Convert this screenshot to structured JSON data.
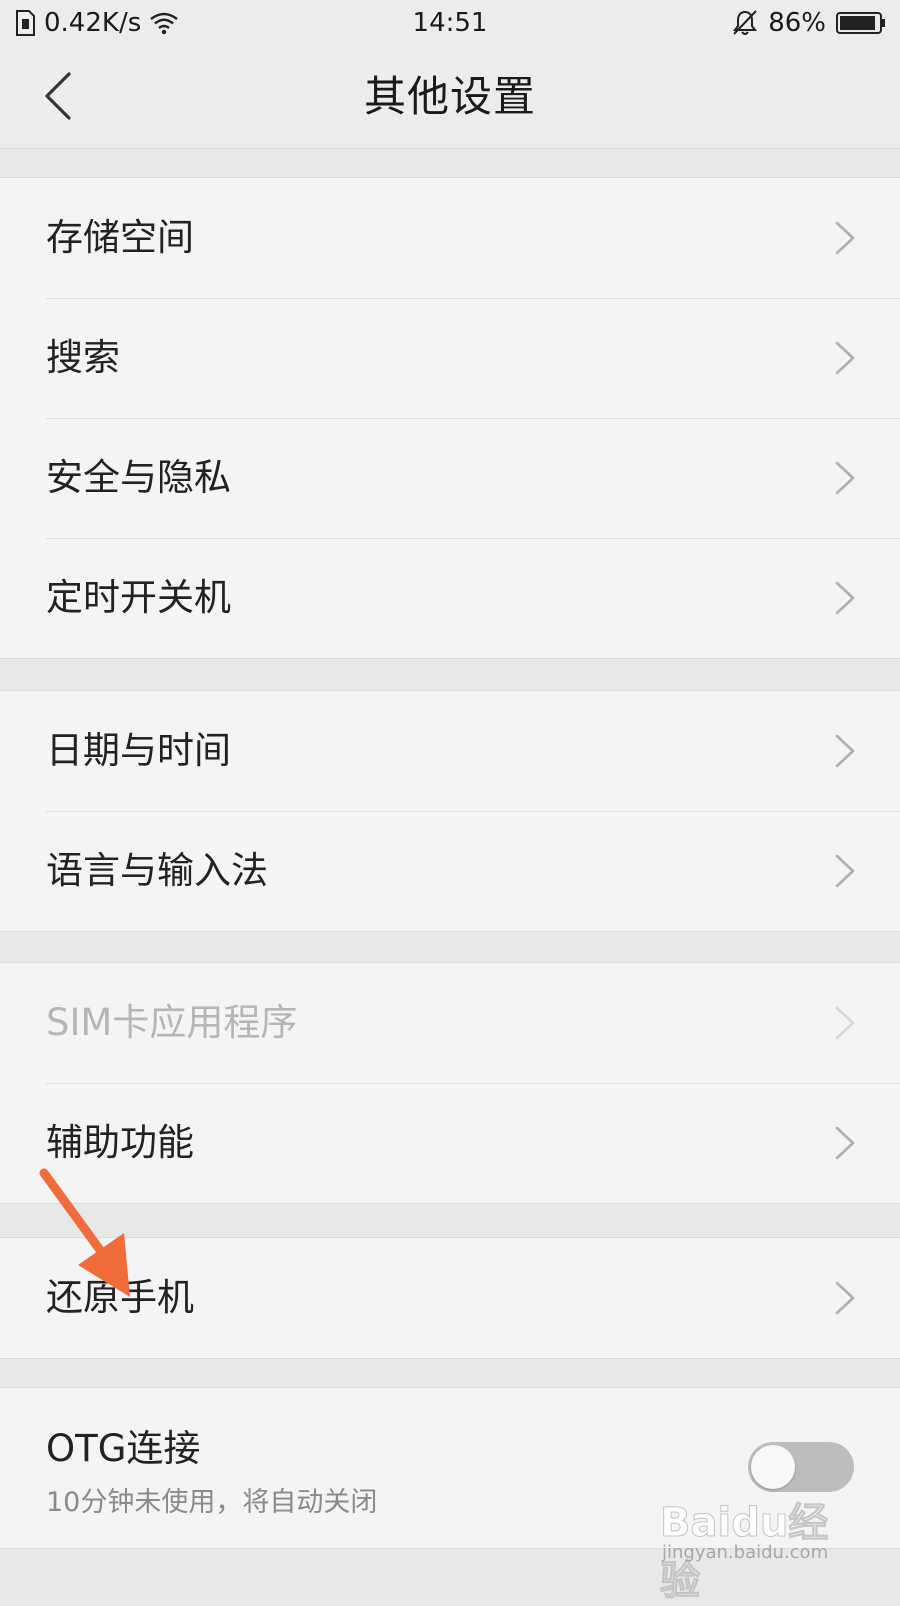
{
  "status_bar": {
    "net_speed": "0.42K/s",
    "time": "14:51",
    "battery": "86%",
    "icons": [
      "sim-icon",
      "wifi-icon",
      "bell-off-icon",
      "battery-icon"
    ]
  },
  "header": {
    "title": "其他设置",
    "back_icon": "chevron-left-icon"
  },
  "groups": [
    {
      "items": [
        {
          "label": "存储空间"
        },
        {
          "label": "搜索"
        },
        {
          "label": "安全与隐私"
        },
        {
          "label": "定时开关机"
        }
      ]
    },
    {
      "items": [
        {
          "label": "日期与时间"
        },
        {
          "label": "语言与输入法"
        }
      ]
    },
    {
      "items": [
        {
          "label": "SIM卡应用程序",
          "disabled": true
        },
        {
          "label": "辅助功能"
        }
      ]
    },
    {
      "items": [
        {
          "label": "还原手机"
        }
      ]
    }
  ],
  "otg": {
    "title": "OTG连接",
    "subtitle": "10分钟未使用，将自动关闭",
    "toggle_on": false
  },
  "annotation": {
    "type": "arrow",
    "color": "#f26b3a",
    "target": "还原手机"
  },
  "watermark": {
    "logo": "Baidu经验",
    "url": "jingyan.baidu.com"
  },
  "colors": {
    "background": "#e8e8e8",
    "card": "#f4f4f4",
    "text": "#222222",
    "disabled_text": "#b5b5b5",
    "toggle_off": "#bdbdbd",
    "accent_arrow": "#f26b3a"
  }
}
